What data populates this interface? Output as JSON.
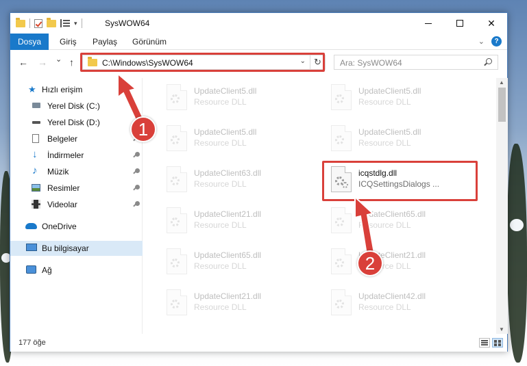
{
  "window": {
    "title": "SysWOW64",
    "controls": {
      "minimize": "—",
      "maximize": "☐",
      "close": "✕"
    }
  },
  "ribbon": {
    "tabs": [
      {
        "label": "Dosya",
        "active": true
      },
      {
        "label": "Giriş",
        "active": false
      },
      {
        "label": "Paylaş",
        "active": false
      },
      {
        "label": "Görünüm",
        "active": false
      }
    ],
    "help": "?"
  },
  "navigation": {
    "back": "←",
    "forward": "→",
    "recent": "⌄",
    "up": "↑",
    "address": "C:\\Windows\\SysWOW64",
    "refresh": "↻",
    "search_placeholder": "Ara: SysWOW64"
  },
  "sidebar": {
    "items": [
      {
        "label": "Hızlı erişim",
        "icon": "star-icon",
        "pinned": false,
        "selected": false
      },
      {
        "label": "Yerel Disk (C:)",
        "icon": "drive-icon",
        "pinned": false,
        "selected": false
      },
      {
        "label": "Yerel Disk (D:)",
        "icon": "drive-icon",
        "pinned": false,
        "selected": false
      },
      {
        "label": "Belgeler",
        "icon": "documents-icon",
        "pinned": true,
        "selected": false
      },
      {
        "label": "İndirmeler",
        "icon": "download-icon",
        "pinned": true,
        "selected": false
      },
      {
        "label": "Müzik",
        "icon": "music-icon",
        "pinned": true,
        "selected": false
      },
      {
        "label": "Resimler",
        "icon": "pictures-icon",
        "pinned": true,
        "selected": false
      },
      {
        "label": "Videolar",
        "icon": "videos-icon",
        "pinned": true,
        "selected": false
      },
      {
        "label": "OneDrive",
        "icon": "cloud-icon",
        "pinned": false,
        "selected": false
      },
      {
        "label": "Bu bilgisayar",
        "icon": "computer-icon",
        "pinned": false,
        "selected": true
      },
      {
        "label": "Ağ",
        "icon": "network-icon",
        "pinned": false,
        "selected": false
      }
    ]
  },
  "files": {
    "left_column": [
      {
        "name": "UpdateClient5.dll",
        "desc": "Resource DLL"
      },
      {
        "name": "UpdateClient5.dll",
        "desc": "Resource DLL"
      },
      {
        "name": "UpdateClient63.dll",
        "desc": "Resource DLL"
      },
      {
        "name": "UpdateClient21.dll",
        "desc": "Resource DLL"
      },
      {
        "name": "UpdateClient65.dll",
        "desc": "Resource DLL"
      },
      {
        "name": "UpdateClient21.dll",
        "desc": "Resource DLL"
      }
    ],
    "right_column": [
      {
        "name": "UpdateClient5.dll",
        "desc": "Resource DLL",
        "highlighted": false
      },
      {
        "name": "UpdateClient5.dll",
        "desc": "Resource DLL",
        "highlighted": false
      },
      {
        "name": "icqstdlg.dll",
        "desc": "ICQSettingsDialogs ...",
        "highlighted": true
      },
      {
        "name": "UpdateClient65.dll",
        "desc": "Resource DLL",
        "highlighted": false
      },
      {
        "name": "UpdateClient21.dll",
        "desc": "Resource DLL",
        "highlighted": false
      },
      {
        "name": "UpdateClient42.dll",
        "desc": "Resource DLL",
        "highlighted": false
      }
    ]
  },
  "status": {
    "item_count": "177 öğe"
  },
  "annotations": {
    "step1": "1",
    "step2": "2",
    "highlight_color": "#d9403a"
  },
  "colors": {
    "accent": "#1979ca",
    "selection": "#d9e9f7"
  }
}
